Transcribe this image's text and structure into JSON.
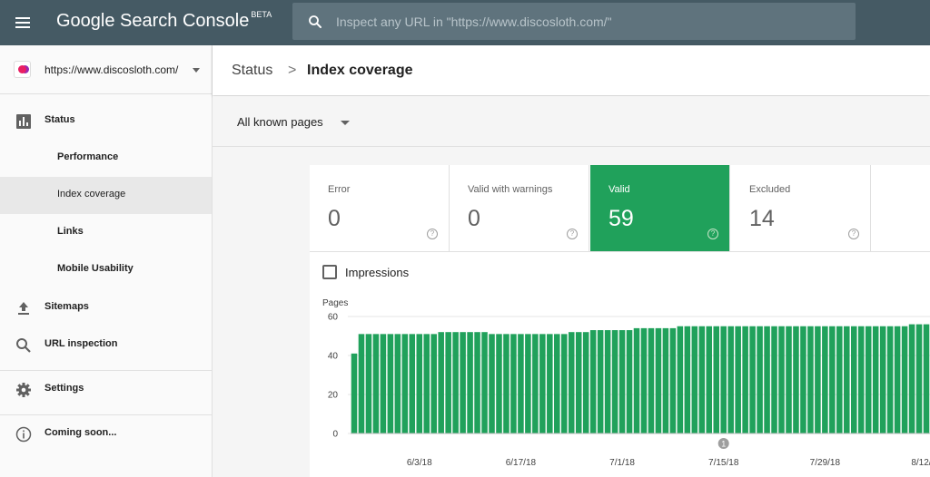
{
  "topbar": {
    "logo_text": "Google Search Console",
    "logo_badge": "BETA",
    "search_placeholder": "Inspect any URL in \"https://www.discosloth.com/\""
  },
  "sidebar": {
    "property_url": "https://www.discosloth.com/",
    "status_label": "Status",
    "sub_items": [
      "Performance",
      "Index coverage",
      "Links",
      "Mobile Usability"
    ],
    "sitemaps_label": "Sitemaps",
    "url_inspection_label": "URL inspection",
    "settings_label": "Settings",
    "coming_soon_label": "Coming soon..."
  },
  "header": {
    "crumb_status": "Status",
    "crumb_sep": ">",
    "crumb_current": "Index coverage"
  },
  "filter": {
    "label": "All known pages"
  },
  "cards": [
    {
      "label": "Error",
      "value": "0",
      "help": "?"
    },
    {
      "label": "Valid with warnings",
      "value": "0",
      "help": "?"
    },
    {
      "label": "Valid",
      "value": "59",
      "help": "?"
    },
    {
      "label": "Excluded",
      "value": "14",
      "help": "?"
    }
  ],
  "impressions_label": "Impressions",
  "colors": {
    "topbar": "#455a64",
    "valid_green": "#20a15b"
  },
  "chart_data": {
    "type": "bar",
    "ylabel": "Pages",
    "ylim": [
      0,
      60
    ],
    "yticks": [
      0,
      20,
      40,
      60
    ],
    "xtick_labels": [
      "6/3/18",
      "6/17/18",
      "7/1/18",
      "7/15/18",
      "7/29/18",
      "8/12/18"
    ],
    "annotation": {
      "label": "1",
      "date": "7/15/18"
    },
    "series": [
      {
        "values": [
          41,
          51,
          51,
          51,
          51,
          51,
          51,
          51,
          51,
          51,
          51,
          51,
          52,
          52,
          52,
          52,
          52,
          52,
          52,
          51,
          51,
          51,
          51,
          51,
          51,
          51,
          51,
          51,
          51,
          51,
          52,
          52,
          52,
          53,
          53,
          53,
          53,
          53,
          53,
          54,
          54,
          54,
          54,
          54,
          54,
          55,
          55,
          55,
          55,
          55,
          55,
          55,
          55,
          55,
          55,
          55,
          55,
          55,
          55,
          55,
          55,
          55,
          55,
          55,
          55,
          55,
          55,
          55,
          55,
          55,
          55,
          55,
          55,
          55,
          55,
          55,
          55,
          56,
          56,
          56
        ]
      }
    ]
  }
}
